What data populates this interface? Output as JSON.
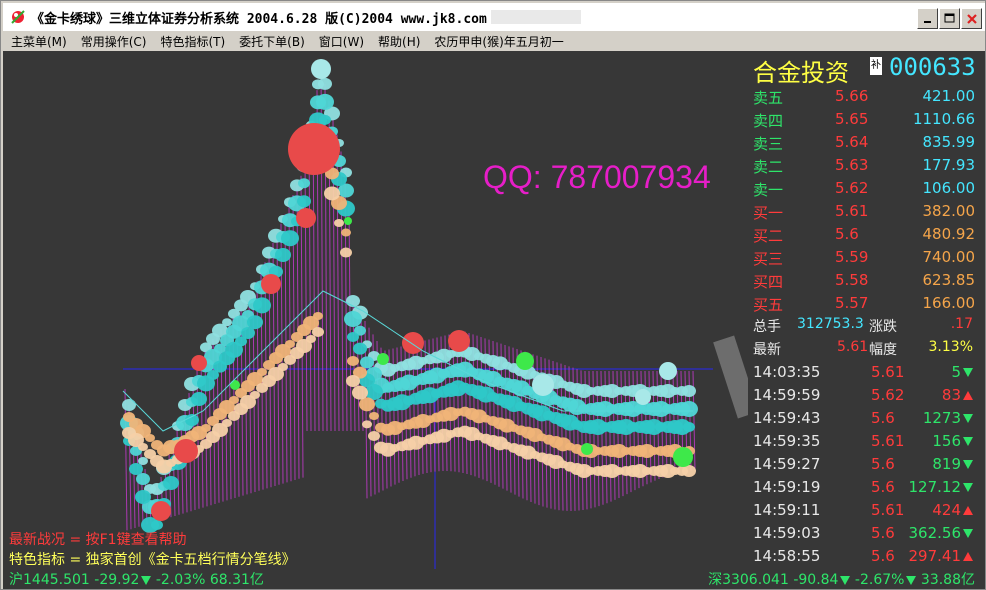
{
  "window": {
    "title": "《金卡绣球》三维立体证券分析系统 2004.6.28 版(C)2004 www.jk8.com"
  },
  "menu": [
    {
      "label": "主菜单(M)"
    },
    {
      "label": "常用操作(C)"
    },
    {
      "label": "特色指标(T)"
    },
    {
      "label": "委托下单(B)"
    },
    {
      "label": "窗口(W)"
    },
    {
      "label": "帮助(H)"
    },
    {
      "label": "农历甲申(猴)年五月初一"
    }
  ],
  "watermark": "QQ: 787007934",
  "notes": {
    "latest": "最新战况 = 按F1键查看帮助",
    "feature": "特色指标 = 独家首创《金卡五档行情分笔线》"
  },
  "index_sh": {
    "label": "沪",
    "value": "1445.501",
    "change": "-29.92",
    "pct": "-2.03%",
    "amount": "68.31亿"
  },
  "index_sz": {
    "label": "深",
    "value": "3306.041",
    "change": "-90.84",
    "pct": "-2.67%",
    "amount": "33.88亿"
  },
  "stock": {
    "name": "合金投资",
    "tag": "补",
    "code": "000633"
  },
  "order_book": [
    {
      "label": "卖五",
      "price": "5.66",
      "volume": "421.00"
    },
    {
      "label": "卖四",
      "price": "5.65",
      "volume": "1110.66"
    },
    {
      "label": "卖三",
      "price": "5.64",
      "volume": "835.99"
    },
    {
      "label": "卖二",
      "price": "5.63",
      "volume": "177.93"
    },
    {
      "label": "卖一",
      "price": "5.62",
      "volume": "106.00"
    },
    {
      "label": "买一",
      "price": "5.61",
      "volume": "382.00"
    },
    {
      "label": "买二",
      "price": "5.6",
      "volume": "480.92"
    },
    {
      "label": "买三",
      "price": "5.59",
      "volume": "740.00"
    },
    {
      "label": "买四",
      "price": "5.58",
      "volume": "623.85"
    },
    {
      "label": "买五",
      "price": "5.57",
      "volume": "166.00"
    }
  ],
  "stats": {
    "total_label": "总手",
    "total": "312753.3",
    "change_label": "涨跌",
    "change": ".17",
    "latest_label": "最新",
    "latest": "5.61",
    "range_label": "幅度",
    "range": "3.13%"
  },
  "ticks": [
    {
      "time": "14:03:35",
      "price": "5.61",
      "volume": "5",
      "dir": "down"
    },
    {
      "time": "14:59:59",
      "price": "5.62",
      "volume": "83",
      "dir": "up"
    },
    {
      "time": "14:59:43",
      "price": "5.6",
      "volume": "1273",
      "dir": "down"
    },
    {
      "time": "14:59:35",
      "price": "5.61",
      "volume": "156",
      "dir": "down"
    },
    {
      "time": "14:59:27",
      "price": "5.6",
      "volume": "819",
      "dir": "down"
    },
    {
      "time": "14:59:19",
      "price": "5.6",
      "volume": "127.12",
      "dir": "down"
    },
    {
      "time": "14:59:11",
      "price": "5.61",
      "volume": "424",
      "dir": "up"
    },
    {
      "time": "14:59:03",
      "price": "5.6",
      "volume": "362.56",
      "dir": "down"
    },
    {
      "time": "14:58:55",
      "price": "5.6",
      "volume": "297.41",
      "dir": "up"
    }
  ],
  "colors": {
    "background": "#373737",
    "sell": "#2ee56a",
    "buy": "#ff3b3b",
    "price": "#ff3b3b",
    "cyan": "#44e6ff",
    "yellow": "#ffff44",
    "orange": "#f5a54a",
    "magenta": "#e61ec8"
  }
}
